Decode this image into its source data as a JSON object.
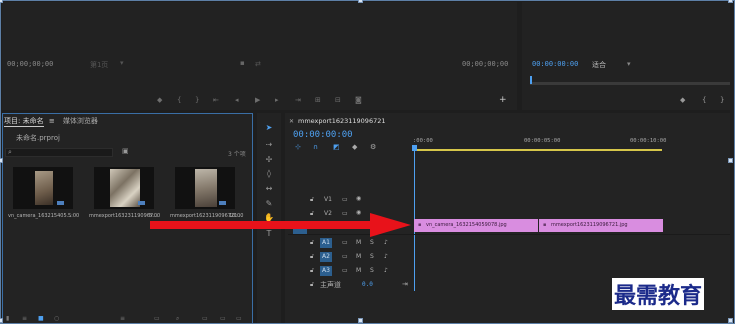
{
  "source_monitor": {
    "timecode_left": "00;00;00;00",
    "timecode_right": "00;00;00;00",
    "page_indicator": "第1页"
  },
  "program_monitor": {
    "timecode": "00:00:00:00",
    "fit_label": "适合"
  },
  "project_panel": {
    "tab_project": "项目: 未命名",
    "tab_media_browser": "媒体浏览器",
    "project_file": "未命名.prproj",
    "item_count": "3 个项",
    "items": [
      {
        "name": "vn_camera_163215405...",
        "duration": "5:00"
      },
      {
        "name": "mmexport163231190967...",
        "duration": "5:00"
      },
      {
        "name": "mmexport1623119096721...",
        "duration": "10:00"
      }
    ]
  },
  "timeline": {
    "sequence_name": "mmexport1623119096721",
    "timecode": "00:00:00:00",
    "ruler": [
      ":00:00",
      "00:00:05:00",
      "00:00:10:00"
    ],
    "video_tracks": [
      "V2",
      "V1"
    ],
    "audio_tracks": [
      "A1",
      "A2",
      "A3"
    ],
    "master_label": "主声道",
    "master_value": "0.0",
    "clips": [
      {
        "name": "vn_camera_1632154059078.jpg"
      },
      {
        "name": "mmexport1623119096721.jpg"
      }
    ]
  },
  "watermark": "最需教育",
  "colors": {
    "accent": "#4ea0f0",
    "clip": "#d98de0",
    "arrow": "#e8121a",
    "playhead": "#4ea0f0"
  }
}
